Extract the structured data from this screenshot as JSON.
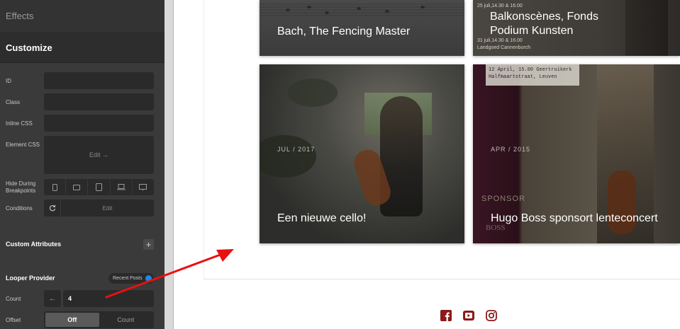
{
  "panel": {
    "effects_label": "Effects",
    "customize_label": "Customize",
    "fields": {
      "id_label": "ID",
      "class_label": "Class",
      "inline_css_label": "Inline CSS",
      "element_css_label": "Element CSS",
      "element_css_edit": "Edit →",
      "hide_label_1": "Hide During",
      "hide_label_2": "Breakpoints",
      "conditions_label": "Conditions",
      "conditions_edit": "Edit"
    },
    "custom_attributes_label": "Custom Attributes",
    "looper_provider_label": "Looper Provider",
    "looper_provider_value": "Recent Posts",
    "count_label": "Count",
    "count_value": "4",
    "offset_label": "Offset",
    "offset_options": [
      "Off",
      "Count"
    ],
    "offset_selected": "Off"
  },
  "preview": {
    "tiles": [
      {
        "title": "Bach, The Fencing Master"
      },
      {
        "title": "Balkonscènes, Fonds Podium Kunsten",
        "overlay_lines": [
          "25 juli,14.30 & 16.00",
          "31 juli,14.30 & 16.00",
          "Landgoed Cannenburch"
        ]
      },
      {
        "title": "Een nieuwe cello!",
        "date": "JUL / 2017"
      },
      {
        "title": "Hugo Boss sponsort lenteconcert",
        "date": "APR / 2015",
        "poster_lines": [
          "12 April, 15.00 Geertruikerk",
          "Halfmaartstraat, Leuven"
        ],
        "sponsor_label": "SPONSOR",
        "boss_label": "BOSS"
      }
    ],
    "social_icons": [
      "facebook-icon",
      "youtube-icon",
      "instagram-icon"
    ]
  },
  "colors": {
    "panel_bg": "#3a3a3a",
    "field_bg": "#2a2a2a",
    "social_accent": "#8b1a1a",
    "arrow": "#e8110f",
    "badge_dot": "#1e88e5"
  }
}
